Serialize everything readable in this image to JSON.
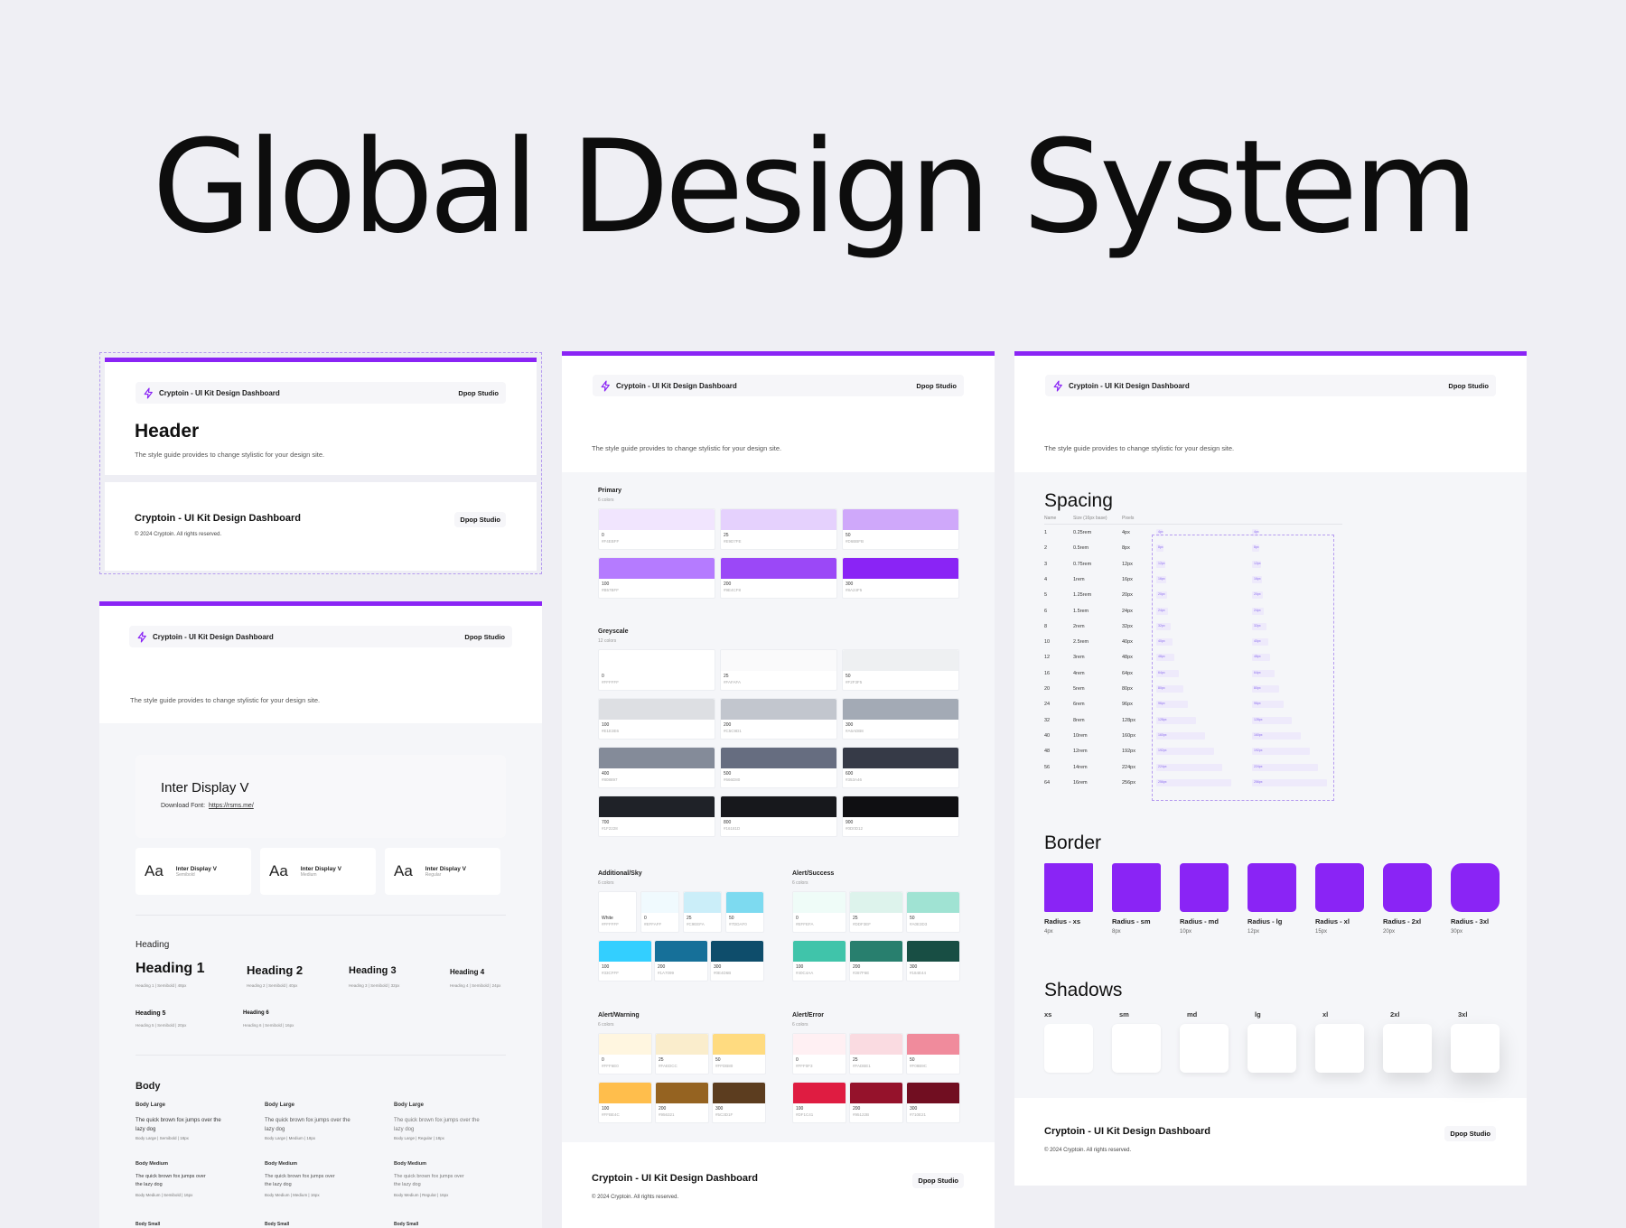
{
  "page_title": "Global Design System",
  "brand": {
    "name": "Cryptoin - UI Kit Design Dashboard",
    "studio": "Dpop Studio",
    "accent": "#8A24F5"
  },
  "header_card": {
    "heading": "Header",
    "desc": "The style guide provides to change stylistic for your design site.",
    "footer_title": "Cryptoin - UI Kit Design Dashboard",
    "copyright": "© 2024 Cryptoin. All rights reserved."
  },
  "typography_card": {
    "desc": "The style guide provides to change stylistic for your design site.",
    "font_name": "Inter Display V",
    "download_label": "Download Font:",
    "download_link": "https://rsms.me/",
    "weights": [
      {
        "sample": "Aa",
        "name": "Inter Display V",
        "weight": "Semibold"
      },
      {
        "sample": "Aa",
        "name": "Inter Display V",
        "weight": "Medium"
      },
      {
        "sample": "Aa",
        "name": "Inter Display V",
        "weight": "Regular"
      }
    ],
    "heading_section": "Heading",
    "headings": [
      {
        "label": "Heading 1",
        "meta": "Heading 1 | Semibold | 48px"
      },
      {
        "label": "Heading 2",
        "meta": "Heading 2 | Semibold | 40px"
      },
      {
        "label": "Heading 3",
        "meta": "Heading 3 | Semibold | 32px"
      },
      {
        "label": "Heading 4",
        "meta": "Heading 4 | Semibold | 24px"
      },
      {
        "label": "Heading 5",
        "meta": "Heading 5 | Semibold | 20px"
      },
      {
        "label": "Heading 6",
        "meta": "Heading 6 | Semibold | 16px"
      }
    ],
    "body_section": "Body",
    "body": [
      {
        "label": "Body Large",
        "text": "The quick brown fox jumps over the lazy dog",
        "meta": "Body Large | Semibold | 18px"
      },
      {
        "label": "Body Large",
        "text": "The quick brown fox jumps over the lazy dog",
        "meta": "Body Large | Medium | 18px"
      },
      {
        "label": "Body Large",
        "text": "The quick brown fox jumps over the lazy dog",
        "meta": "Body Large | Regular | 18px"
      },
      {
        "label": "Body Medium",
        "text": "The quick brown fox jumps over the lazy dog",
        "meta": "Body Medium | Semibold | 16px"
      },
      {
        "label": "Body Medium",
        "text": "The quick brown fox jumps over the lazy dog",
        "meta": "Body Medium | Medium | 16px"
      },
      {
        "label": "Body Medium",
        "text": "The quick brown fox jumps over the lazy dog",
        "meta": "Body Medium | Regular | 16px"
      },
      {
        "label": "Body Small"
      },
      {
        "label": "Body Small"
      },
      {
        "label": "Body Small"
      }
    ]
  },
  "colors_card": {
    "desc": "The style guide provides to change stylistic for your design site.",
    "primary": {
      "title": "Primary",
      "count": "6 colors",
      "swatches": [
        {
          "n": "0",
          "h": "#F4EBFF",
          "c": "#F1E5FE"
        },
        {
          "n": "25",
          "h": "#E9D7FE",
          "c": "#E5D1FD"
        },
        {
          "n": "50",
          "h": "#D6BBFB",
          "c": "#CFA8FA"
        },
        {
          "n": "100",
          "h": "#B57BFF",
          "c": "#B57BFF"
        },
        {
          "n": "200",
          "h": "#9E4CF8",
          "c": "#9B48F7"
        },
        {
          "n": "300",
          "h": "#8A24F5",
          "c": "#8A24F5"
        }
      ]
    },
    "greyscale": {
      "title": "Greyscale",
      "count": "12 colors",
      "swatches": [
        {
          "n": "0",
          "h": "#FFFFFF",
          "c": "#FFFFFF"
        },
        {
          "n": "25",
          "h": "#FAFAFA",
          "c": "#FAFAFB"
        },
        {
          "n": "50",
          "h": "#F2F3F5",
          "c": "#EEF0F2"
        },
        {
          "n": "100",
          "h": "#E1E3E6",
          "c": "#DDDFE3"
        },
        {
          "n": "200",
          "h": "#C5C9D1",
          "c": "#C2C6CE"
        },
        {
          "n": "300",
          "h": "#A6ADB8",
          "c": "#A3AAB5"
        },
        {
          "n": "400",
          "h": "#808897",
          "c": "#848B99"
        },
        {
          "n": "500",
          "h": "#666D80",
          "c": "#666D80"
        },
        {
          "n": "600",
          "h": "#353A46",
          "c": "#363A47"
        },
        {
          "n": "700",
          "h": "#1F2228",
          "c": "#1F2228"
        },
        {
          "n": "800",
          "h": "#16181D",
          "c": "#17181C"
        },
        {
          "n": "900",
          "h": "#0D0D12",
          "c": "#0F0F12"
        }
      ]
    },
    "sky": {
      "title": "Additional/Sky",
      "count": "6 colors",
      "swatches": [
        {
          "n": "White",
          "h": "#FFFFFF",
          "c": "#FFFFFF"
        },
        {
          "n": "0",
          "h": "#EFFAFF",
          "c": "#F0FAFE"
        },
        {
          "n": "25",
          "h": "#C9EEFA",
          "c": "#CBEEF9"
        },
        {
          "n": "50",
          "h": "#7DDAF0",
          "c": "#7DDAF0"
        },
        {
          "n": "100",
          "h": "#33CFFF",
          "c": "#33CFFF"
        },
        {
          "n": "200",
          "h": "#1A7099",
          "c": "#167099"
        },
        {
          "n": "300",
          "h": "#0E4D6B",
          "c": "#0E4D6B"
        }
      ]
    },
    "success": {
      "title": "Alert/Success",
      "count": "6 colors",
      "swatches": [
        {
          "n": "0",
          "h": "#EFFEFA",
          "c": "#EFFCF8"
        },
        {
          "n": "25",
          "h": "#DDF3EF",
          "c": "#DDF3EC"
        },
        {
          "n": "50",
          "h": "#A0E3D3",
          "c": "#A0E3D3"
        },
        {
          "n": "100",
          "h": "#40C4AA",
          "c": "#40C4AA"
        },
        {
          "n": "200",
          "h": "#287F6E",
          "c": "#287F6E"
        },
        {
          "n": "300",
          "h": "#184E44",
          "c": "#184E44"
        }
      ]
    },
    "warning": {
      "title": "Alert/Warning",
      "count": "6 colors",
      "swatches": [
        {
          "n": "0",
          "h": "#FFF6E0",
          "c": "#FFF6E0"
        },
        {
          "n": "25",
          "h": "#FAEDCC",
          "c": "#FAEDCC"
        },
        {
          "n": "50",
          "h": "#FFDB80",
          "c": "#FFDB80"
        },
        {
          "n": "100",
          "h": "#FFBE4C",
          "c": "#FFBE4C"
        },
        {
          "n": "200",
          "h": "#956321",
          "c": "#956321"
        },
        {
          "n": "300",
          "h": "#5C3D1F",
          "c": "#5C3D1F"
        }
      ]
    },
    "error": {
      "title": "Alert/Error",
      "count": "6 colors",
      "swatches": [
        {
          "n": "0",
          "h": "#FFF0F3",
          "c": "#FFF0F3"
        },
        {
          "n": "25",
          "h": "#FADBE1",
          "c": "#FADBE1"
        },
        {
          "n": "50",
          "h": "#F08B9C",
          "c": "#F08B9C"
        },
        {
          "n": "100",
          "h": "#DF1C41",
          "c": "#DF1C41"
        },
        {
          "n": "200",
          "h": "#95122B",
          "c": "#95122B"
        },
        {
          "n": "300",
          "h": "#710E21",
          "c": "#710E21"
        }
      ]
    },
    "footer_title": "Cryptoin - UI Kit Design Dashboard",
    "copyright": "© 2024 Cryptoin. All rights reserved."
  },
  "spacing_card": {
    "desc": "The style guide provides to change stylistic for your design site.",
    "spacing_title": "Spacing",
    "columns": [
      "Name",
      "Size (16px base)",
      "Pixels"
    ],
    "rows": [
      {
        "name": "1",
        "size": "0.25rem",
        "px": "4px",
        "v": 4
      },
      {
        "name": "2",
        "size": "0.5rem",
        "px": "8px",
        "v": 8
      },
      {
        "name": "3",
        "size": "0.75rem",
        "px": "12px",
        "v": 12
      },
      {
        "name": "4",
        "size": "1rem",
        "px": "16px",
        "v": 16
      },
      {
        "name": "5",
        "size": "1.25rem",
        "px": "20px",
        "v": 20
      },
      {
        "name": "6",
        "size": "1.5rem",
        "px": "24px",
        "v": 24
      },
      {
        "name": "8",
        "size": "2rem",
        "px": "32px",
        "v": 32
      },
      {
        "name": "10",
        "size": "2.5rem",
        "px": "40px",
        "v": 40
      },
      {
        "name": "12",
        "size": "3rem",
        "px": "48px",
        "v": 48
      },
      {
        "name": "16",
        "size": "4rem",
        "px": "64px",
        "v": 64
      },
      {
        "name": "20",
        "size": "5rem",
        "px": "80px",
        "v": 80
      },
      {
        "name": "24",
        "size": "6rem",
        "px": "96px",
        "v": 96
      },
      {
        "name": "32",
        "size": "8rem",
        "px": "128px",
        "v": 128
      },
      {
        "name": "40",
        "size": "10rem",
        "px": "160px",
        "v": 160
      },
      {
        "name": "48",
        "size": "12rem",
        "px": "192px",
        "v": 192
      },
      {
        "name": "56",
        "size": "14rem",
        "px": "224px",
        "v": 224
      },
      {
        "name": "64",
        "size": "16rem",
        "px": "256px",
        "v": 256
      }
    ],
    "border_title": "Border",
    "borders": [
      {
        "label": "Radius - xs",
        "px": "4px",
        "r": 4
      },
      {
        "label": "Radius - sm",
        "px": "8px",
        "r": 8
      },
      {
        "label": "Radius - md",
        "px": "10px",
        "r": 10
      },
      {
        "label": "Radius - lg",
        "px": "12px",
        "r": 12
      },
      {
        "label": "Radius - xl",
        "px": "15px",
        "r": 15
      },
      {
        "label": "Radius - 2xl",
        "px": "20px",
        "r": 20
      },
      {
        "label": "Radius - 3xl",
        "px": "30px",
        "r": 30
      }
    ],
    "shadows_title": "Shadows",
    "shadows": [
      "xs",
      "sm",
      "md",
      "lg",
      "xl",
      "2xl",
      "3xl"
    ],
    "footer_title": "Cryptoin - UI Kit Design Dashboard",
    "copyright": "© 2024 Cryptoin. All rights reserved."
  }
}
